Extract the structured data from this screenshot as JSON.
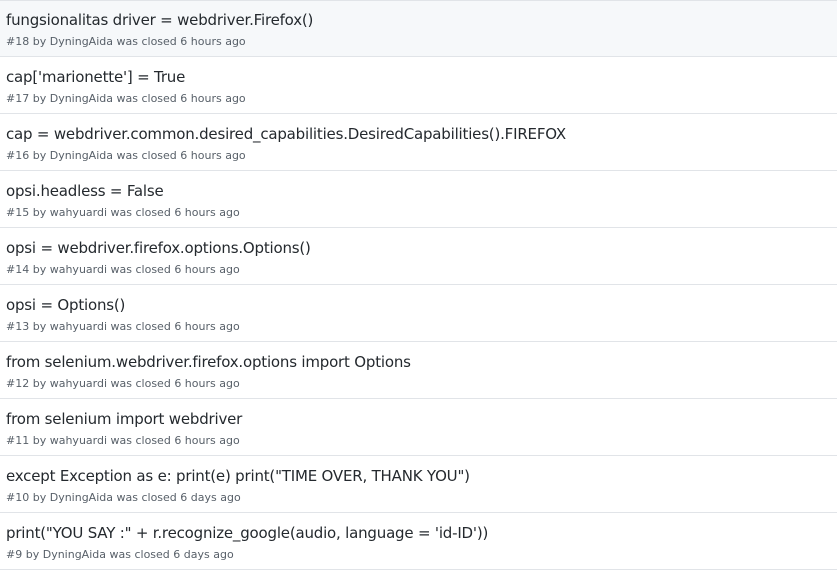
{
  "issues": [
    {
      "title": "fungsionalitas driver = webdriver.Firefox()",
      "number": "#18",
      "by": "by",
      "author": "DyningAida",
      "status": "was closed",
      "time": "6 hours ago"
    },
    {
      "title": "cap['marionette'] = True",
      "number": "#17",
      "by": "by",
      "author": "DyningAida",
      "status": "was closed",
      "time": "6 hours ago"
    },
    {
      "title": "cap = webdriver.common.desired_capabilities.DesiredCapabilities().FIREFOX",
      "number": "#16",
      "by": "by",
      "author": "DyningAida",
      "status": "was closed",
      "time": "6 hours ago"
    },
    {
      "title": "opsi.headless = False",
      "number": "#15",
      "by": "by",
      "author": "wahyuardi",
      "status": "was closed",
      "time": "6 hours ago"
    },
    {
      "title": "opsi = webdriver.firefox.options.Options()",
      "number": "#14",
      "by": "by",
      "author": "wahyuardi",
      "status": "was closed",
      "time": "6 hours ago"
    },
    {
      "title": "opsi = Options()",
      "number": "#13",
      "by": "by",
      "author": "wahyuardi",
      "status": "was closed",
      "time": "6 hours ago"
    },
    {
      "title": "from selenium.webdriver.firefox.options import Options",
      "number": "#12",
      "by": "by",
      "author": "wahyuardi",
      "status": "was closed",
      "time": "6 hours ago"
    },
    {
      "title": "from selenium import webdriver",
      "number": "#11",
      "by": "by",
      "author": "wahyuardi",
      "status": "was closed",
      "time": "6 hours ago"
    },
    {
      "title": "except Exception as e: print(e) print(\"TIME OVER, THANK YOU\")",
      "number": "#10",
      "by": "by",
      "author": "DyningAida",
      "status": "was closed",
      "time": "6 days ago"
    },
    {
      "title": "print(\"YOU SAY :\" + r.recognize_google(audio, language = 'id-ID'))",
      "number": "#9",
      "by": "by",
      "author": "DyningAida",
      "status": "was closed",
      "time": "6 days ago"
    }
  ]
}
